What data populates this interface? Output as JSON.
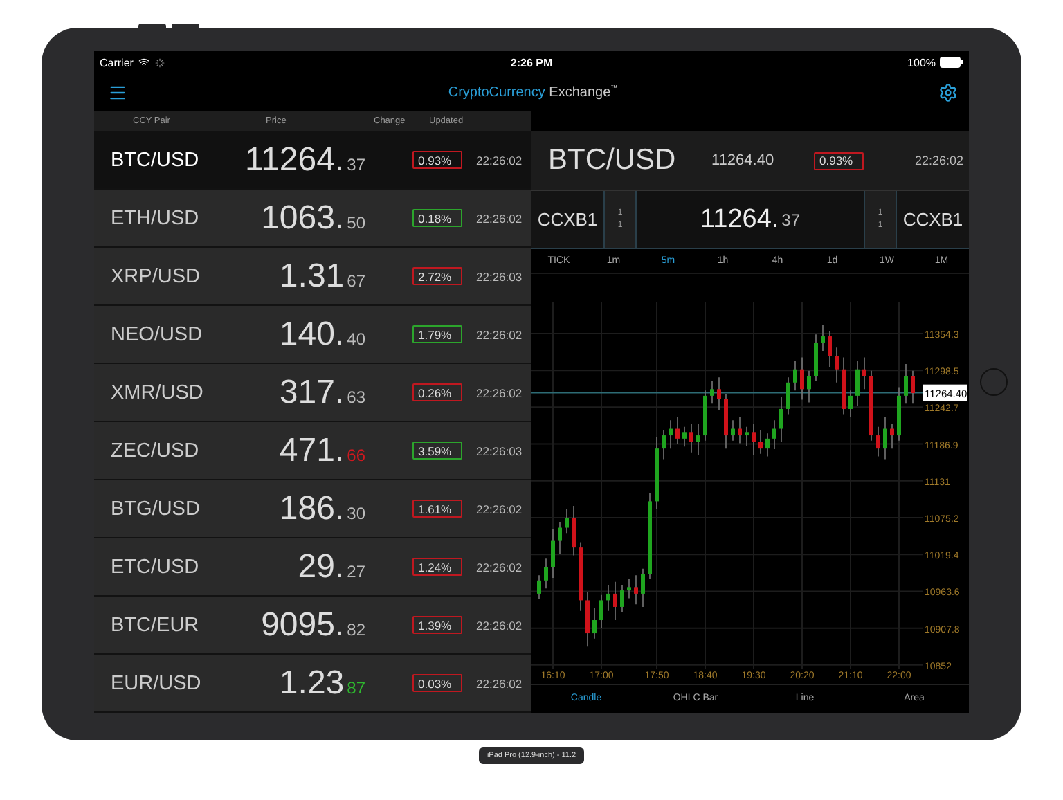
{
  "status_bar": {
    "carrier": "Carrier",
    "time": "2:26 PM",
    "battery": "100%"
  },
  "nav": {
    "title_brand": "CryptoCurrency",
    "title_rest": "Exchange",
    "title_mark": "™"
  },
  "columns": [
    "CCY Pair",
    "Price",
    "Change",
    "Updated"
  ],
  "rows": [
    {
      "pair": "BTC/USD",
      "price_int": "11264.",
      "price_dec": "37",
      "change": "0.93%",
      "rising": false,
      "updated": "22:26:02",
      "selected": true
    },
    {
      "pair": "ETH/USD",
      "price_int": "1063.",
      "price_dec": "50",
      "change": "0.18%",
      "rising": true,
      "updated": "22:26:02",
      "selected": false
    },
    {
      "pair": "XRP/USD",
      "price_int": "1.31",
      "price_dec": "67",
      "change": "2.72%",
      "rising": false,
      "updated": "22:26:03",
      "selected": false
    },
    {
      "pair": "NEO/USD",
      "price_int": "140.",
      "price_dec": "40",
      "change": "1.79%",
      "rising": true,
      "updated": "22:26:02",
      "selected": false
    },
    {
      "pair": "XMR/USD",
      "price_int": "317.",
      "price_dec": "63",
      "change": "0.26%",
      "rising": false,
      "updated": "22:26:02",
      "selected": false
    },
    {
      "pair": "ZEC/USD",
      "price_int": "471.",
      "price_dec": "66",
      "color": "#d0181f",
      "change": "3.59%",
      "rising": true,
      "updated": "22:26:03",
      "selected": false
    },
    {
      "pair": "BTG/USD",
      "price_int": "186.",
      "price_dec": "30",
      "change": "1.61%",
      "rising": false,
      "updated": "22:26:02",
      "selected": false
    },
    {
      "pair": "ETC/USD",
      "price_int": "29.",
      "price_dec": "27",
      "change": "1.24%",
      "rising": false,
      "updated": "22:26:02",
      "selected": false
    },
    {
      "pair": "BTC/EUR",
      "price_int": "9095.",
      "price_dec": "82",
      "change": "1.39%",
      "rising": false,
      "updated": "22:26:02",
      "selected": false
    },
    {
      "pair": "EUR/USD",
      "price_int": "1.23",
      "price_dec": "87",
      "color": "#2eb82e",
      "change": "0.03%",
      "rising": false,
      "updated": "22:26:02",
      "selected": false
    }
  ],
  "detail": {
    "pair": "BTC/USD",
    "price": "11264.40",
    "change": "0.93%",
    "rising": false,
    "updated": "22:26:02"
  },
  "quote": {
    "left_venue": "CCXB1",
    "left_sizes": [
      "1",
      "1"
    ],
    "price_int": "11264.",
    "price_dec": "37",
    "right_sizes": [
      "1",
      "1"
    ],
    "right_venue": "CCXB1"
  },
  "timeframes": [
    {
      "label": "TICK",
      "selected": false
    },
    {
      "label": "1m",
      "selected": false
    },
    {
      "label": "5m",
      "selected": true
    },
    {
      "label": "1h",
      "selected": false
    },
    {
      "label": "4h",
      "selected": false
    },
    {
      "label": "1d",
      "selected": false
    },
    {
      "label": "1W",
      "selected": false
    },
    {
      "label": "1M",
      "selected": false
    }
  ],
  "chart": {
    "last_price": "11264.40",
    "chart_data": {
      "type": "candlestick",
      "yticks": [
        11354.3,
        11298.5,
        11242.7,
        11186.9,
        11131,
        11075.2,
        11019.4,
        10963.6,
        10907.8,
        10852
      ],
      "ylim": [
        10846.6,
        11402.5
      ],
      "grid": true,
      "ref_lines": [
        {
          "axis": "y",
          "value": 11264.4,
          "color": "#2d6b74"
        }
      ],
      "categories": [
        null,
        null,
        "16:10",
        null,
        null,
        null,
        null,
        null,
        null,
        "17:00",
        null,
        null,
        null,
        null,
        null,
        null,
        null,
        "17:50",
        null,
        null,
        null,
        null,
        null,
        null,
        "18:40",
        null,
        null,
        null,
        null,
        null,
        null,
        "19:30",
        null,
        null,
        null,
        null,
        null,
        null,
        "20:20",
        null,
        null,
        null,
        null,
        null,
        null,
        "21:10",
        null,
        null,
        null,
        null,
        null,
        null,
        "22:00",
        null,
        null
      ],
      "ohlc": [
        [
          10960,
          10988,
          10952,
          10980
        ],
        [
          10980,
          11013,
          10968,
          11000
        ],
        [
          11000,
          11058,
          10984,
          11040
        ],
        [
          11040,
          11068,
          11020,
          11060
        ],
        [
          11060,
          11088,
          11052,
          11075
        ],
        [
          11075,
          11093,
          11018,
          11030
        ],
        [
          11030,
          11038,
          10934,
          10950
        ],
        [
          10950,
          10963,
          10880,
          10900
        ],
        [
          10900,
          10938,
          10892,
          10920
        ],
        [
          10920,
          10958,
          10908,
          10950
        ],
        [
          10950,
          10973,
          10934,
          10960
        ],
        [
          10960,
          10978,
          10920,
          10940
        ],
        [
          10940,
          10973,
          10932,
          10965
        ],
        [
          10965,
          10983,
          10953,
          10970
        ],
        [
          10970,
          10988,
          10944,
          10960
        ],
        [
          10960,
          10998,
          10940,
          10990
        ],
        [
          10990,
          11113,
          10982,
          11100
        ],
        [
          11100,
          11198,
          11088,
          11180
        ],
        [
          11180,
          11208,
          11164,
          11200
        ],
        [
          11200,
          11223,
          11180,
          11210
        ],
        [
          11210,
          11228,
          11187,
          11195
        ],
        [
          11195,
          11213,
          11183,
          11205
        ],
        [
          11205,
          11218,
          11174,
          11190
        ],
        [
          11190,
          11218,
          11170,
          11200
        ],
        [
          11200,
          11268,
          11192,
          11260
        ],
        [
          11260,
          11283,
          11248,
          11270
        ],
        [
          11270,
          11288,
          11239,
          11255
        ],
        [
          11255,
          11263,
          11180,
          11200
        ],
        [
          11200,
          11223,
          11192,
          11210
        ],
        [
          11210,
          11228,
          11188,
          11200
        ],
        [
          11200,
          11213,
          11184,
          11205
        ],
        [
          11205,
          11218,
          11170,
          11190
        ],
        [
          11190,
          11208,
          11172,
          11180
        ],
        [
          11180,
          11203,
          11168,
          11195
        ],
        [
          11195,
          11223,
          11179,
          11210
        ],
        [
          11210,
          11258,
          11190,
          11240
        ],
        [
          11240,
          11288,
          11232,
          11280
        ],
        [
          11280,
          11313,
          11268,
          11300
        ],
        [
          11300,
          11318,
          11254,
          11270
        ],
        [
          11270,
          11298,
          11250,
          11290
        ],
        [
          11290,
          11353,
          11282,
          11340
        ],
        [
          11340,
          11368,
          11328,
          11350
        ],
        [
          11350,
          11358,
          11304,
          11320
        ],
        [
          11320,
          11333,
          11280,
          11300
        ],
        [
          11300,
          11318,
          11232,
          11240
        ],
        [
          11240,
          11268,
          11228,
          11260
        ],
        [
          11260,
          11313,
          11244,
          11300
        ],
        [
          11300,
          11318,
          11270,
          11290
        ],
        [
          11290,
          11298,
          11192,
          11200
        ],
        [
          11200,
          11213,
          11168,
          11180
        ],
        [
          11180,
          11228,
          11164,
          11210
        ],
        [
          11210,
          11218,
          11180,
          11200
        ],
        [
          11200,
          11273,
          11192,
          11260
        ],
        [
          11260,
          11308,
          11248,
          11290
        ],
        [
          11290,
          11298,
          11248,
          11264
        ]
      ]
    }
  },
  "chart_types": [
    {
      "label": "Candle",
      "selected": true
    },
    {
      "label": "OHLC Bar",
      "selected": false
    },
    {
      "label": "Line",
      "selected": false
    },
    {
      "label": "Area",
      "selected": false
    }
  ],
  "device_label": "iPad Pro (12.9-inch) - 11.2"
}
